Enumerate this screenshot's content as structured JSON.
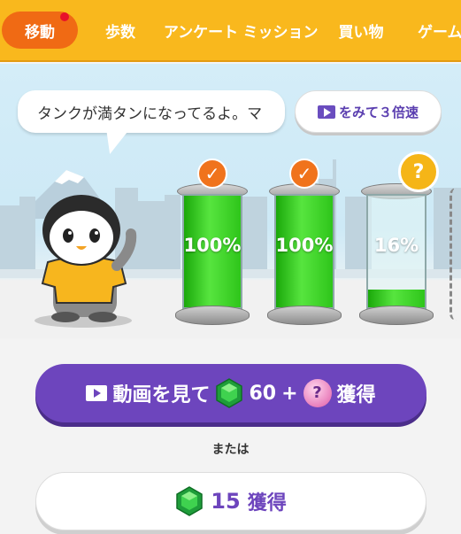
{
  "tabs": [
    {
      "label": "移動",
      "active": true,
      "notification_dot": true
    },
    {
      "label": "歩数",
      "active": false
    },
    {
      "label": "アンケート",
      "active": false
    },
    {
      "label": "ミッション",
      "active": false
    },
    {
      "label": "買い物",
      "active": false
    },
    {
      "label": "ゲーム",
      "active": false
    }
  ],
  "bubble": {
    "text": "タンクが満タンになってるよ。マ"
  },
  "speed_button": {
    "label": "をみて３倍速",
    "icon": "video-icon"
  },
  "tanks": [
    {
      "percent_label": "100%",
      "fill_fraction": 1.0,
      "badge": "check"
    },
    {
      "percent_label": "100%",
      "fill_fraction": 1.0,
      "badge": "check"
    },
    {
      "percent_label": "16%",
      "fill_fraction": 0.16,
      "badge": "question"
    }
  ],
  "watch_button": {
    "prefix": "動画を見て",
    "amount": "60",
    "plus": "+",
    "suffix": "獲得"
  },
  "or_text": "または",
  "gem_button": {
    "amount": "15",
    "suffix": "獲得"
  },
  "colors": {
    "tab_bar": "#f9b81d",
    "tab_active": "#f06a14",
    "primary_purple": "#6d45bd",
    "tank_green": "#2ec51a",
    "check_badge": "#f0731c",
    "question_badge": "#f5b517"
  }
}
